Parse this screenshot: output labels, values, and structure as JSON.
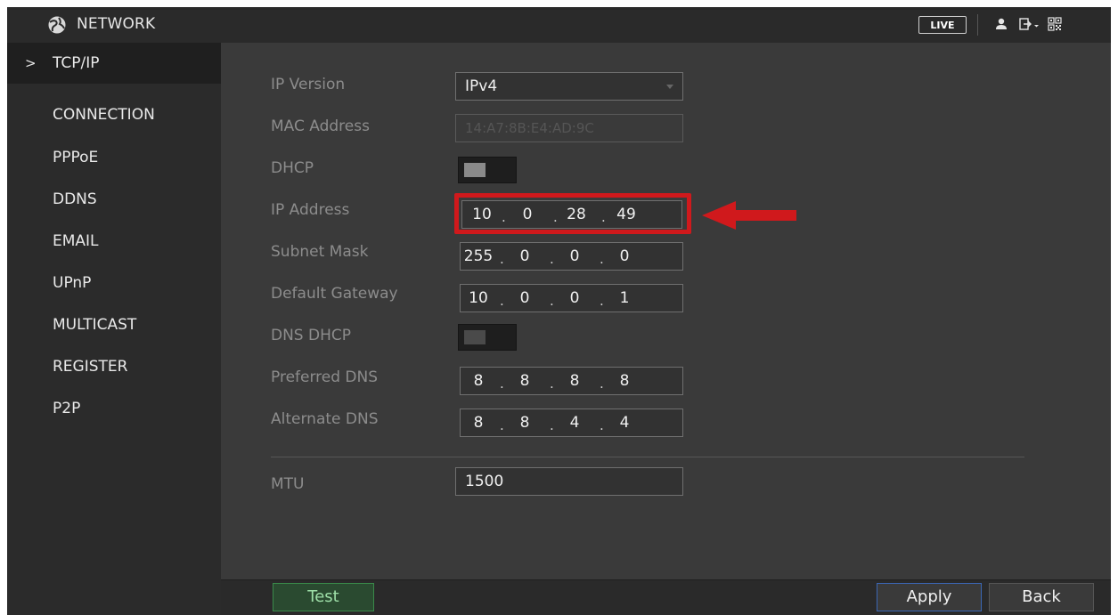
{
  "header": {
    "title": "NETWORK",
    "live_label": "LIVE",
    "icons": [
      "globe-network-icon",
      "user-icon",
      "logout-icon",
      "qr-code-icon"
    ]
  },
  "sidebar": {
    "items": [
      {
        "label": "TCP/IP",
        "active": true
      },
      {
        "label": "CONNECTION"
      },
      {
        "label": "PPPoE"
      },
      {
        "label": "DDNS"
      },
      {
        "label": "EMAIL"
      },
      {
        "label": "UPnP"
      },
      {
        "label": "MULTICAST"
      },
      {
        "label": "REGISTER"
      },
      {
        "label": "P2P"
      }
    ]
  },
  "form": {
    "ip_version": {
      "label": "IP Version",
      "value": "IPv4"
    },
    "mac_address": {
      "label": "MAC Address",
      "value": "14:A7:8B:E4:AD:9C"
    },
    "dhcp": {
      "label": "DHCP",
      "enabled": false
    },
    "ip_address": {
      "label": "IP Address",
      "octets": [
        "10",
        "0",
        "28",
        "49"
      ]
    },
    "subnet_mask": {
      "label": "Subnet Mask",
      "octets": [
        "255",
        "0",
        "0",
        "0"
      ]
    },
    "default_gateway": {
      "label": "Default Gateway",
      "octets": [
        "10",
        "0",
        "0",
        "1"
      ]
    },
    "dns_dhcp": {
      "label": "DNS DHCP",
      "enabled": false
    },
    "preferred_dns": {
      "label": "Preferred DNS",
      "octets": [
        "8",
        "8",
        "8",
        "8"
      ]
    },
    "alternate_dns": {
      "label": "Alternate DNS",
      "octets": [
        "8",
        "8",
        "4",
        "4"
      ]
    },
    "mtu": {
      "label": "MTU",
      "value": "1500"
    }
  },
  "footer": {
    "test_label": "Test",
    "apply_label": "Apply",
    "back_label": "Back"
  },
  "colors": {
    "highlight": "#d0191c",
    "test_button_border": "#3a8a4a",
    "apply_button_border": "#3b66b4"
  }
}
